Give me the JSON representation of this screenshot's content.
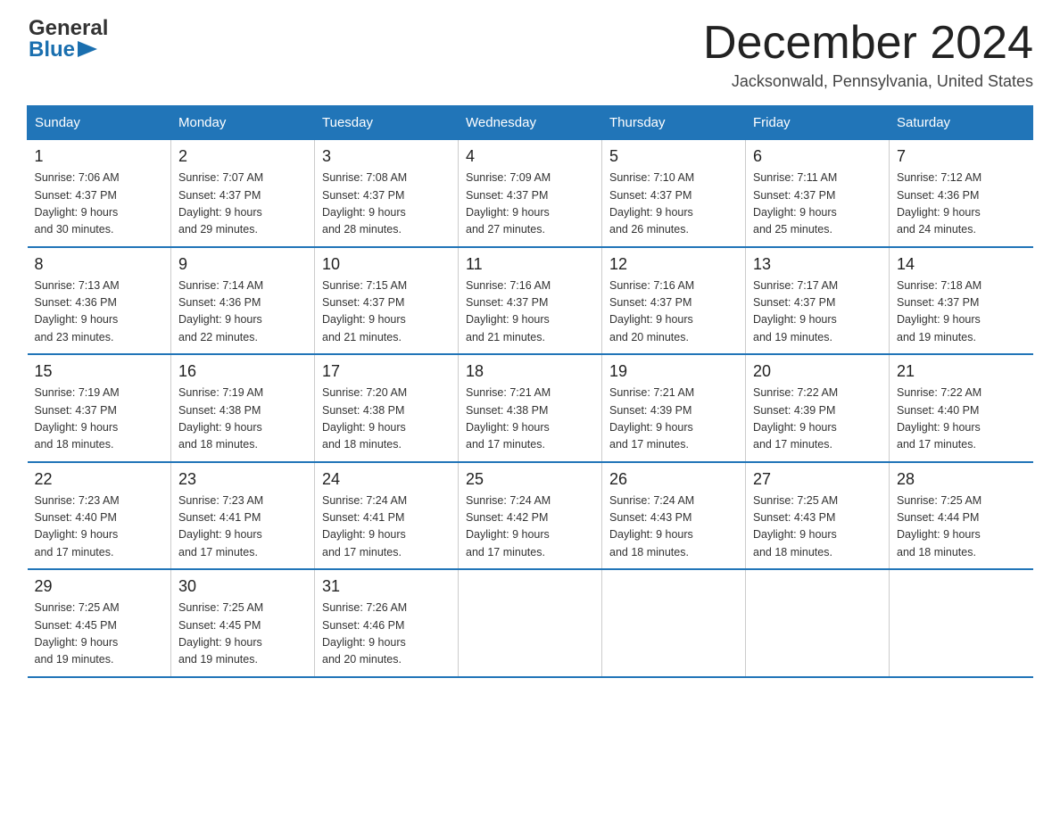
{
  "header": {
    "logo_general": "General",
    "logo_blue": "Blue",
    "month_title": "December 2024",
    "location": "Jacksonwald, Pennsylvania, United States"
  },
  "days_of_week": [
    "Sunday",
    "Monday",
    "Tuesday",
    "Wednesday",
    "Thursday",
    "Friday",
    "Saturday"
  ],
  "weeks": [
    [
      {
        "day": "1",
        "sunrise": "7:06 AM",
        "sunset": "4:37 PM",
        "daylight": "9 hours and 30 minutes."
      },
      {
        "day": "2",
        "sunrise": "7:07 AM",
        "sunset": "4:37 PM",
        "daylight": "9 hours and 29 minutes."
      },
      {
        "day": "3",
        "sunrise": "7:08 AM",
        "sunset": "4:37 PM",
        "daylight": "9 hours and 28 minutes."
      },
      {
        "day": "4",
        "sunrise": "7:09 AM",
        "sunset": "4:37 PM",
        "daylight": "9 hours and 27 minutes."
      },
      {
        "day": "5",
        "sunrise": "7:10 AM",
        "sunset": "4:37 PM",
        "daylight": "9 hours and 26 minutes."
      },
      {
        "day": "6",
        "sunrise": "7:11 AM",
        "sunset": "4:37 PM",
        "daylight": "9 hours and 25 minutes."
      },
      {
        "day": "7",
        "sunrise": "7:12 AM",
        "sunset": "4:36 PM",
        "daylight": "9 hours and 24 minutes."
      }
    ],
    [
      {
        "day": "8",
        "sunrise": "7:13 AM",
        "sunset": "4:36 PM",
        "daylight": "9 hours and 23 minutes."
      },
      {
        "day": "9",
        "sunrise": "7:14 AM",
        "sunset": "4:36 PM",
        "daylight": "9 hours and 22 minutes."
      },
      {
        "day": "10",
        "sunrise": "7:15 AM",
        "sunset": "4:37 PM",
        "daylight": "9 hours and 21 minutes."
      },
      {
        "day": "11",
        "sunrise": "7:16 AM",
        "sunset": "4:37 PM",
        "daylight": "9 hours and 21 minutes."
      },
      {
        "day": "12",
        "sunrise": "7:16 AM",
        "sunset": "4:37 PM",
        "daylight": "9 hours and 20 minutes."
      },
      {
        "day": "13",
        "sunrise": "7:17 AM",
        "sunset": "4:37 PM",
        "daylight": "9 hours and 19 minutes."
      },
      {
        "day": "14",
        "sunrise": "7:18 AM",
        "sunset": "4:37 PM",
        "daylight": "9 hours and 19 minutes."
      }
    ],
    [
      {
        "day": "15",
        "sunrise": "7:19 AM",
        "sunset": "4:37 PM",
        "daylight": "9 hours and 18 minutes."
      },
      {
        "day": "16",
        "sunrise": "7:19 AM",
        "sunset": "4:38 PM",
        "daylight": "9 hours and 18 minutes."
      },
      {
        "day": "17",
        "sunrise": "7:20 AM",
        "sunset": "4:38 PM",
        "daylight": "9 hours and 18 minutes."
      },
      {
        "day": "18",
        "sunrise": "7:21 AM",
        "sunset": "4:38 PM",
        "daylight": "9 hours and 17 minutes."
      },
      {
        "day": "19",
        "sunrise": "7:21 AM",
        "sunset": "4:39 PM",
        "daylight": "9 hours and 17 minutes."
      },
      {
        "day": "20",
        "sunrise": "7:22 AM",
        "sunset": "4:39 PM",
        "daylight": "9 hours and 17 minutes."
      },
      {
        "day": "21",
        "sunrise": "7:22 AM",
        "sunset": "4:40 PM",
        "daylight": "9 hours and 17 minutes."
      }
    ],
    [
      {
        "day": "22",
        "sunrise": "7:23 AM",
        "sunset": "4:40 PM",
        "daylight": "9 hours and 17 minutes."
      },
      {
        "day": "23",
        "sunrise": "7:23 AM",
        "sunset": "4:41 PM",
        "daylight": "9 hours and 17 minutes."
      },
      {
        "day": "24",
        "sunrise": "7:24 AM",
        "sunset": "4:41 PM",
        "daylight": "9 hours and 17 minutes."
      },
      {
        "day": "25",
        "sunrise": "7:24 AM",
        "sunset": "4:42 PM",
        "daylight": "9 hours and 17 minutes."
      },
      {
        "day": "26",
        "sunrise": "7:24 AM",
        "sunset": "4:43 PM",
        "daylight": "9 hours and 18 minutes."
      },
      {
        "day": "27",
        "sunrise": "7:25 AM",
        "sunset": "4:43 PM",
        "daylight": "9 hours and 18 minutes."
      },
      {
        "day": "28",
        "sunrise": "7:25 AM",
        "sunset": "4:44 PM",
        "daylight": "9 hours and 18 minutes."
      }
    ],
    [
      {
        "day": "29",
        "sunrise": "7:25 AM",
        "sunset": "4:45 PM",
        "daylight": "9 hours and 19 minutes."
      },
      {
        "day": "30",
        "sunrise": "7:25 AM",
        "sunset": "4:45 PM",
        "daylight": "9 hours and 19 minutes."
      },
      {
        "day": "31",
        "sunrise": "7:26 AM",
        "sunset": "4:46 PM",
        "daylight": "9 hours and 20 minutes."
      },
      null,
      null,
      null,
      null
    ]
  ],
  "sunrise_label": "Sunrise: ",
  "sunset_label": "Sunset: ",
  "daylight_label": "Daylight: "
}
